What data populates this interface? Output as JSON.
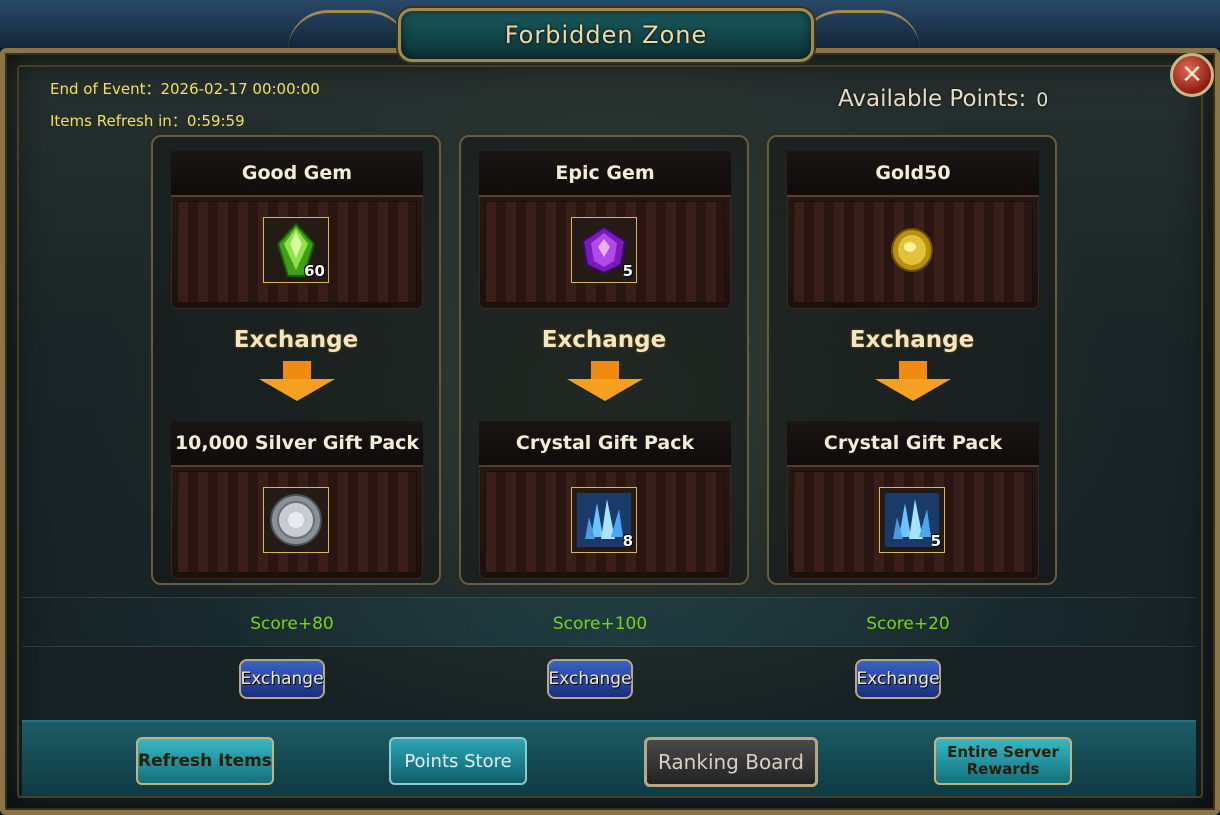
{
  "window": {
    "title": "Forbidden Zone"
  },
  "info": {
    "end_of_event": "End of Event：2026-02-17 00:00:00",
    "items_refresh": "Items Refresh in：0:59:59"
  },
  "points": {
    "label": "Available Points:",
    "value": "0"
  },
  "exchange_label": "Exchange",
  "cards": [
    {
      "give": {
        "name": "Good Gem",
        "icon": "green-gem-icon",
        "qty": "60"
      },
      "get": {
        "name": "10,000 Silver Gift Pack",
        "icon": "silver-coin-icon",
        "qty": ""
      },
      "score": "Score+80",
      "button": "Exchange"
    },
    {
      "give": {
        "name": "Epic Gem",
        "icon": "purple-gem-icon",
        "qty": "5"
      },
      "get": {
        "name": "Crystal Gift Pack",
        "icon": "blue-crystal-icon",
        "qty": "8"
      },
      "score": "Score+100",
      "button": "Exchange"
    },
    {
      "give": {
        "name": "Gold50",
        "icon": "gold-coin-icon",
        "qty": ""
      },
      "get": {
        "name": "Crystal Gift Pack",
        "icon": "blue-crystal-icon",
        "qty": "5"
      },
      "score": "Score+20",
      "button": "Exchange"
    }
  ],
  "bottom_buttons": {
    "refresh": "Refresh Items",
    "points_store": "Points Store",
    "ranking": "Ranking Board",
    "server_rewards_line1": "Entire Server",
    "server_rewards_line2": "Rewards"
  },
  "colors": {
    "info_text": "#f1e25a",
    "score_text": "#78d41a",
    "frame_gold": "#8a7448",
    "title_teal": "#1a5a5e"
  }
}
